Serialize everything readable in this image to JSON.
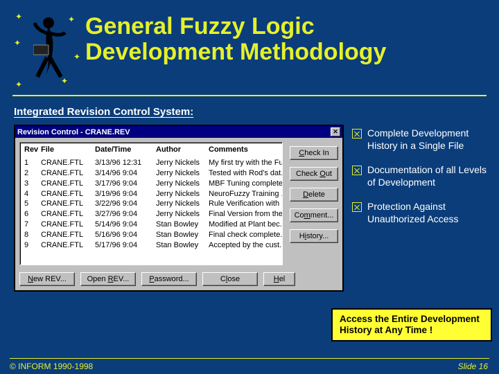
{
  "header": {
    "title_line1": "General Fuzzy Logic",
    "title_line2": "Development Methodology"
  },
  "subtitle": "Integrated Revision Control System:",
  "dialog": {
    "title": "Revision Control - CRANE.REV",
    "columns": {
      "rev": "Rev",
      "file": "File",
      "datetime": "Date/Time",
      "author": "Author",
      "comments": "Comments"
    },
    "rows": [
      {
        "rev": "1",
        "file": "CRANE.FTL",
        "dt": "3/13/96  12:31",
        "author": "Jerry Nickels",
        "comment": "My first try with the Fuz."
      },
      {
        "rev": "2",
        "file": "CRANE.FTL",
        "dt": "3/14/96   9:04",
        "author": "Jerry Nickels",
        "comment": "Tested with Rod's dat."
      },
      {
        "rev": "3",
        "file": "CRANE.FTL",
        "dt": "3/17/96   9:04",
        "author": "Jerry Nickels",
        "comment": "MBF Tuning complete."
      },
      {
        "rev": "4",
        "file": "CRANE.FTL",
        "dt": "3/19/96   9:04",
        "author": "Jerry Nickels",
        "comment": "NeuroFuzzy Training ."
      },
      {
        "rev": "5",
        "file": "CRANE.FTL",
        "dt": "3/22/96   9:04",
        "author": "Jerry Nickels",
        "comment": "Rule Verification with ."
      },
      {
        "rev": "6",
        "file": "CRANE.FTL",
        "dt": "3/27/96   9:04",
        "author": "Jerry Nickels",
        "comment": "Final Version from the."
      },
      {
        "rev": "7",
        "file": "CRANE.FTL",
        "dt": "5/14/96   9:04",
        "author": "Stan Bowley",
        "comment": "Modified at Plant bec."
      },
      {
        "rev": "8",
        "file": "CRANE.FTL",
        "dt": "5/16/96   9:04",
        "author": "Stan Bowley",
        "comment": "Final check complete."
      },
      {
        "rev": "9",
        "file": "CRANE.FTL",
        "dt": "5/17/96   9:04",
        "author": "Stan Bowley",
        "comment": "Accepted by the cust."
      }
    ],
    "side_buttons": {
      "check_in": "Check In",
      "check_out": "Check Out",
      "delete": "Delete",
      "comment": "Comment...",
      "history": "History..."
    },
    "bottom_buttons": {
      "new_rev": "New REV...",
      "open_rev": "Open REV...",
      "password": "Password...",
      "close": "Close",
      "help": "Help"
    }
  },
  "bullets": [
    "Complete Development History in a Single File",
    "Documentation of all Levels of Development",
    "Protection Against Unauthorized Access"
  ],
  "callout": "Access the Entire Development History at Any Time !",
  "footer": {
    "copyright": "© INFORM 1990-1998",
    "slide": "Slide 16"
  }
}
